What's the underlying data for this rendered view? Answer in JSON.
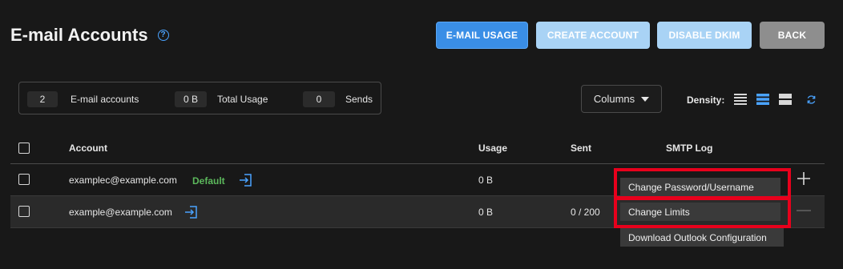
{
  "page": {
    "title": "E-mail Accounts",
    "help_icon": "question-circle-icon"
  },
  "header_buttons": {
    "email_usage": "E-MAIL USAGE",
    "create_account": "CREATE ACCOUNT",
    "disable_dkim": "DISABLE DKIM",
    "back": "BACK"
  },
  "summary": {
    "accounts_value": "2",
    "accounts_label": "E-mail accounts",
    "usage_value": "0 B",
    "usage_label": "Total Usage",
    "sends_value": "0",
    "sends_label": "Sends"
  },
  "toolbar": {
    "columns_label": "Columns",
    "density_label": "Density:",
    "density_options": [
      "compact",
      "standard",
      "comfortable"
    ],
    "density_selected": "standard"
  },
  "table": {
    "headers": {
      "account": "Account",
      "usage": "Usage",
      "sent": "Sent",
      "smtp_log": "SMTP Log"
    },
    "rows": [
      {
        "account": "examplec@example.com",
        "badge": "Default",
        "usage": "0 B",
        "sent": ""
      },
      {
        "account": "example@example.com",
        "badge": "",
        "usage": "0 B",
        "sent": "0 / 200"
      }
    ]
  },
  "context_menu": {
    "items": [
      "Change Password/Username",
      "Change Limits",
      "Download Outlook Configuration"
    ]
  },
  "colors": {
    "background": "#181818",
    "primary_button": "#3a8ee6",
    "light_button": "#a9d3f5",
    "back_button": "#8e8e8e",
    "default_badge": "#5cb85c",
    "highlight": "#e8001c",
    "accent_icon": "#4aa3ff"
  }
}
